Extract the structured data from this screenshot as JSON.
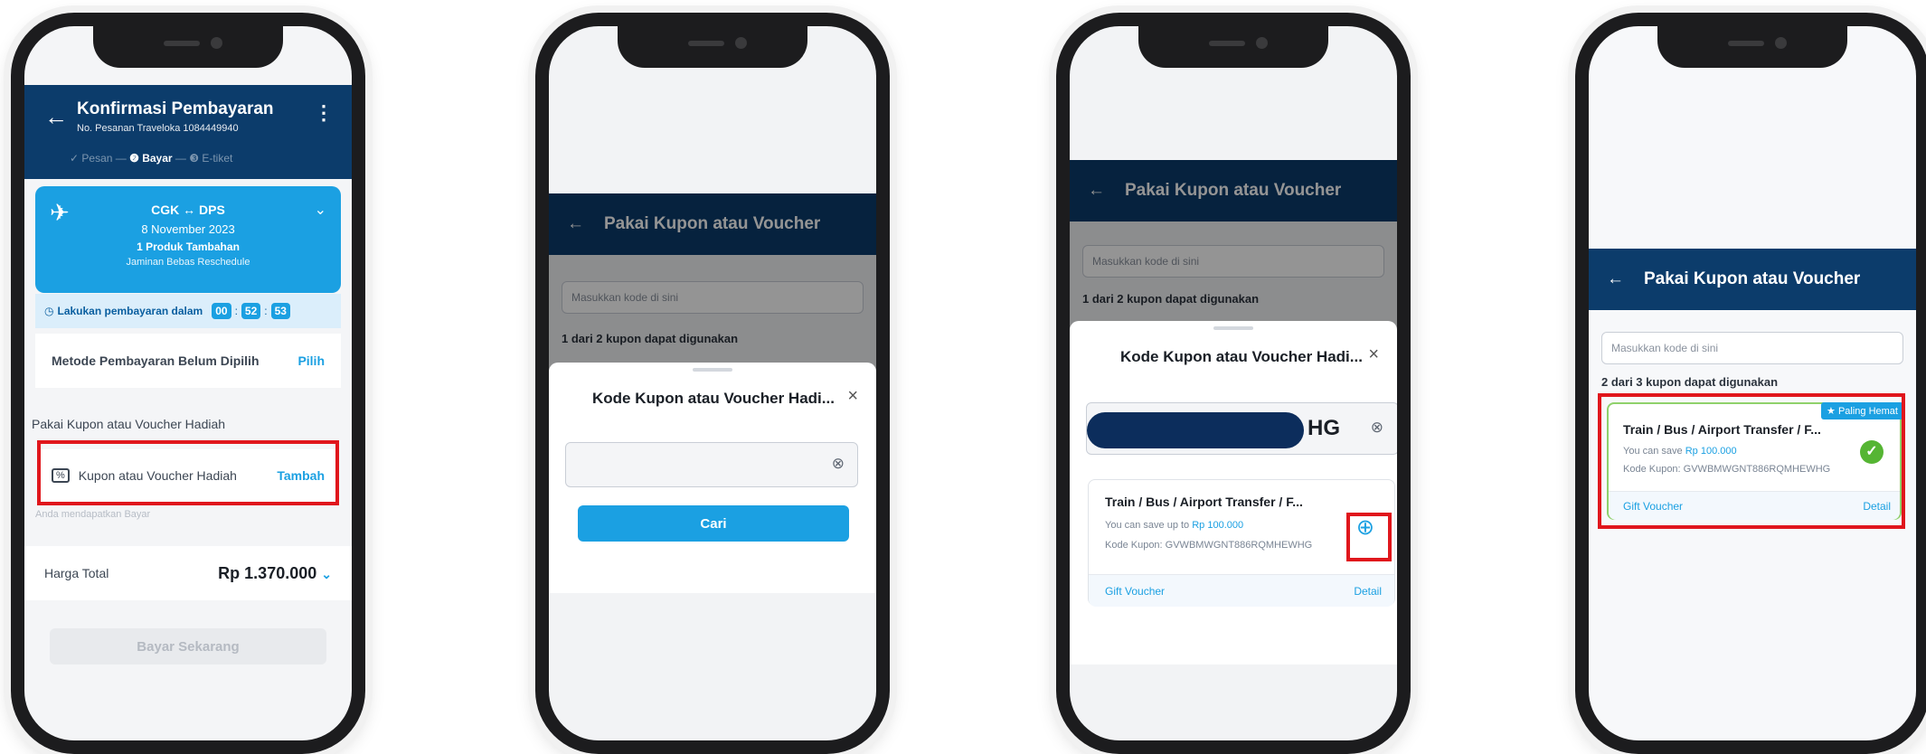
{
  "screen1": {
    "title": "Konfirmasi Pembayaran",
    "order_no": "No. Pesanan Traveloka 1084449940",
    "steps": [
      "✓ Pesan",
      "Bayar",
      "E-tiket"
    ],
    "route": "CGK ↔ DPS",
    "date": "8 November 2023",
    "addon": "1 Produk Tambahan",
    "addon_detail": "Jaminan Bebas Reschedule",
    "timer_label": "Lakukan pembayaran dalam",
    "timer": [
      "00",
      "52",
      "53"
    ],
    "payment_method": "Metode Pembayaran Belum Dipilih",
    "pilih": "Pilih",
    "voucher_section": "Pakai Kupon atau Voucher Hadiah",
    "voucher_row": "Kupon atau Voucher Hadiah",
    "tambah": "Tambah",
    "under_text": "Anda mendapatkan Bayar",
    "total_label": "Harga Total",
    "total_value": "Rp 1.370.000",
    "pay_button": "Bayar Sekarang"
  },
  "header_title": "Pakai Kupon atau Voucher",
  "input_placeholder": "Masukkan kode di sini",
  "available_1": "1 dari 2 kupon dapat digunakan",
  "available_2": "2 dari 3 kupon dapat digunakan",
  "sheet_title": "Kode Kupon atau Voucher Hadi...",
  "search_button": "Cari",
  "code_suffix": "HG",
  "coupon": {
    "name": "Train / Bus / Airport Transfer / F...",
    "save_up_to": "You can save up to",
    "save": "You can save",
    "amount": "Rp 100.000",
    "code": "Kode Kupon: GVWBMWGNT886RQMHEWHG",
    "type": "Gift Voucher",
    "detail": "Detail",
    "badge": "Paling Hemat"
  },
  "colors": {
    "brand_dark": "#0c3c6b",
    "brand_blue": "#1ba0e2",
    "highlight": "#e0161c"
  }
}
